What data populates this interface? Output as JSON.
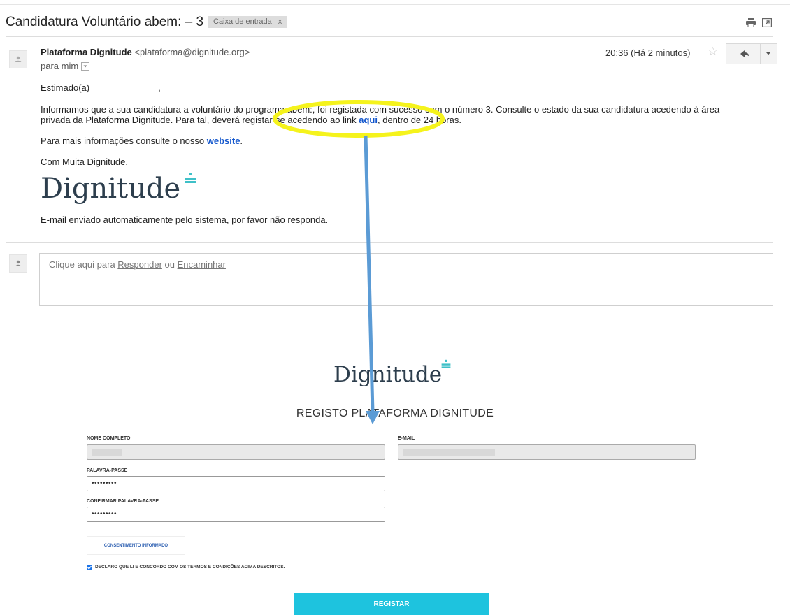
{
  "email": {
    "subject": "Candidatura Voluntário abem: – 3",
    "label_chip": "Caixa de entrada",
    "label_chip_close": "x",
    "sender_name": "Plataforma Dignitude",
    "sender_email": "<plataforma@dignitude.org>",
    "recipient": "para mim",
    "time": "20:36 (Há 2 minutos)",
    "greeting": "Estimado(a)",
    "greeting_comma": ",",
    "body_line1": "Informamos que a sua candidatura a voluntário do programa abem:, foi registada com sucesso com o número 3. Consulte o estado da sua candidatura acedendo à área",
    "body_line2_a": "privada da Plataforma Dignitude. Para tal, deverá registar-se acedendo ao link ",
    "body_link_aqui": "aqui",
    "body_line2_b": ", dentro de 24 horas.",
    "info_line_a": "Para mais informações consulte o nosso ",
    "info_link_website": "website",
    "info_line_b": ".",
    "signoff": "Com Muita Dignitude,",
    "logo_text": "Dignitude",
    "auto_note": "E-mail enviado automaticamente pelo sistema, por favor não responda.",
    "reply_prompt_a": "Clique aqui para ",
    "reply_link": "Responder",
    "reply_prompt_b": " ou ",
    "forward_link": "Encaminhar"
  },
  "form": {
    "logo_text": "Dignitude",
    "title": "REGISTO PLATAFORMA DIGNITUDE",
    "name_label": "NOME COMPLETO",
    "email_label": "E-MAIL",
    "password_label": "PALAVRA-PASSE",
    "password_value": "•••••••••",
    "confirm_label": "CONFIRMAR PALAVRA-PASSE",
    "confirm_value": "•••••••••",
    "consent_button": "CONSENTIMENTO INFORMADO",
    "checkbox_label": "DECLARO QUE LI E CONCORDO COM OS TERMOS E CONDIÇÕES ACIMA DESCRITOS.",
    "checkbox_checked": true,
    "submit_button": "REGISTAR"
  },
  "colors": {
    "link": "#1155cc",
    "annotation_ellipse": "#f5f31c",
    "annotation_arrow": "#5b9bd5",
    "logo_accent": "#3fc0c8",
    "submit_bg": "#1ec3de"
  },
  "icons": {
    "print": "print-icon",
    "new_window": "new-window-icon",
    "avatar": "person-icon",
    "star": "star-icon",
    "reply": "reply-icon",
    "more": "caret-down-icon",
    "checkbox": "checkmark-icon"
  }
}
